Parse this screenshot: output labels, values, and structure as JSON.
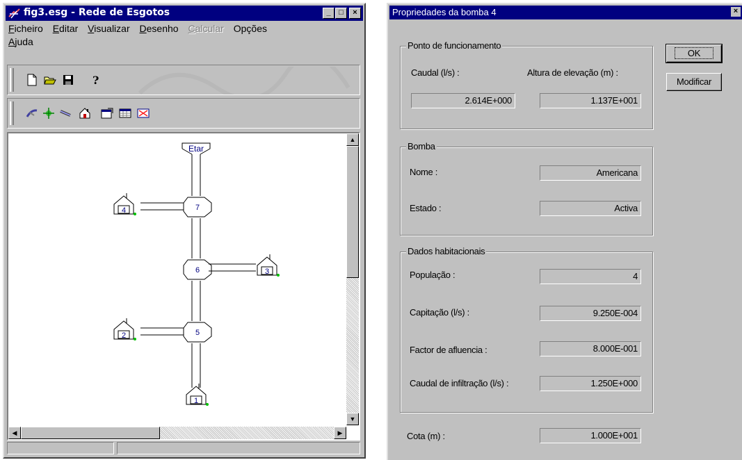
{
  "app_window": {
    "title": "fig3.esg - Rede de Esgotos",
    "controls": [
      "_",
      "□",
      "×"
    ],
    "menu": [
      {
        "label": "Ficheiro",
        "underline": "F",
        "rest": "icheiro",
        "enabled": true
      },
      {
        "label": "Editar",
        "underline": "E",
        "rest": "ditar",
        "enabled": true
      },
      {
        "label": "Visualizar",
        "underline": "V",
        "rest": "isualizar",
        "enabled": true
      },
      {
        "label": "Desenho",
        "underline": "D",
        "rest": "esenho",
        "enabled": true
      },
      {
        "label": "Calcular",
        "underline": "C",
        "rest": "alcular",
        "enabled": false
      },
      {
        "label": "Opções",
        "underline": "",
        "rest": "Opções",
        "enabled": true
      },
      {
        "label": "Ajuda",
        "underline": "A",
        "rest": "juda",
        "enabled": true
      }
    ],
    "toolbar1_icons": [
      "new-file-icon",
      "open-folder-icon",
      "save-disk-icon",
      "help-question-icon"
    ],
    "toolbar2_icons": [
      "pipe-tool-icon",
      "node-tool-icon",
      "link-tool-icon",
      "house-tool-icon",
      "properties-icon",
      "table-icon",
      "delete-icon"
    ],
    "diagram": {
      "outlet_label": "Etar",
      "nodes": [
        "7",
        "6",
        "5"
      ],
      "houses": [
        "4",
        "3",
        "2",
        "1"
      ]
    }
  },
  "dialog": {
    "title": "Propriedades da bomba 4",
    "close_label": "×",
    "ok_label": "OK",
    "modify_label": "Modificar",
    "operating_point": {
      "legend": "Ponto de funcionamento",
      "flow_label": "Caudal (l/s) :",
      "head_label": "Altura de elevação (m) :",
      "flow_value": "2.614E+000",
      "head_value": "1.137E+001"
    },
    "pump": {
      "legend": "Bomba",
      "name_label": "Nome :",
      "name_value": "Americana",
      "state_label": "Estado :",
      "state_value": "Activa"
    },
    "housing": {
      "legend": "Dados habitacionais",
      "population_label": "População :",
      "population_value": "4",
      "capitation_label": "Capitação (l/s) :",
      "capitation_value": "9.250E-004",
      "inflow_factor_label": "Factor de afluencia :",
      "inflow_factor_value": "8.000E-001",
      "infiltration_label": "Caudal de infiltração (l/s) :",
      "infiltration_value": "1.250E+000"
    },
    "elevation_label": "Cota (m) :",
    "elevation_value": "1.000E+001"
  }
}
